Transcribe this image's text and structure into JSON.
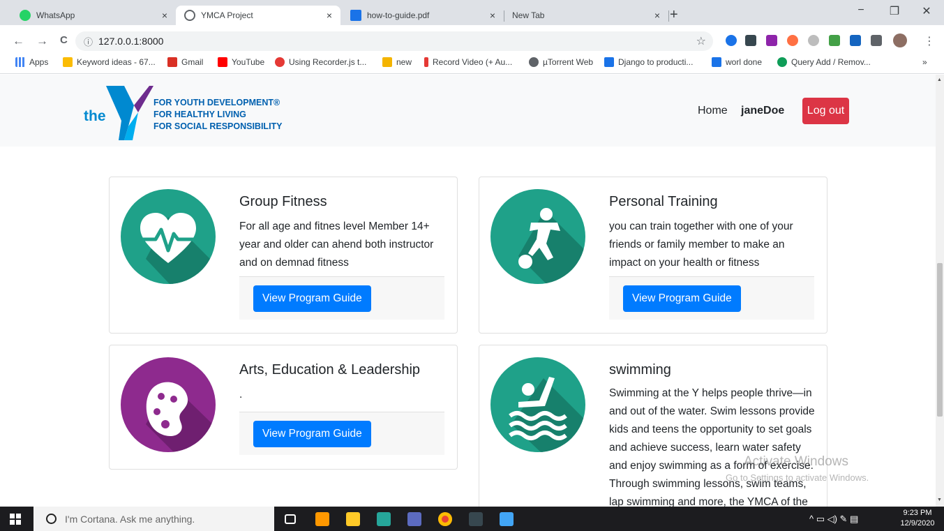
{
  "browser": {
    "tabs": [
      {
        "title": "WhatsApp",
        "icon": "whatsapp-icon",
        "active": false
      },
      {
        "title": "YMCA Project",
        "icon": "globe-icon",
        "active": true
      },
      {
        "title": "how-to-guide.pdf",
        "icon": "pdf-icon",
        "active": false
      },
      {
        "title": "New Tab",
        "icon": "",
        "active": false
      }
    ],
    "tab_close": "×",
    "new_tab": "+",
    "window_controls": {
      "minimize": "−",
      "restore": "❐",
      "close": "✕"
    },
    "nav": {
      "back": "←",
      "forward": "→",
      "reload": "C"
    },
    "url": "127.0.0.1:8000",
    "url_info": "ⓘ",
    "star": "☆",
    "bookmarks": [
      {
        "label": "Apps",
        "color": "#ea4335"
      },
      {
        "label": "Keyword ideas - 67...",
        "color": "#fbbc04"
      },
      {
        "label": "Gmail",
        "color": "#d93025"
      },
      {
        "label": "YouTube",
        "color": "#ff0000"
      },
      {
        "label": "Using Recorder.js t...",
        "color": "#e53935"
      },
      {
        "label": "new",
        "color": "#f4b400"
      },
      {
        "label": "Record Video (+ Au...",
        "color": "#e53935"
      },
      {
        "label": "µTorrent Web",
        "color": "#5f6368"
      },
      {
        "label": "Django to producti...",
        "color": "#1a73e8"
      },
      {
        "label": "worl done",
        "color": "#1a73e8"
      },
      {
        "label": "Query Add / Remov...",
        "color": "#0f9d58"
      }
    ],
    "bookmarks_more": "»"
  },
  "site": {
    "logo": {
      "the": "the",
      "tagline": [
        "FOR YOUTH DEVELOPMENT®",
        "FOR HEALTHY LIVING",
        "FOR SOCIAL RESPONSIBILITY"
      ]
    },
    "nav": {
      "home": "Home",
      "user": "janeDoe",
      "logout": "Log out"
    },
    "cards": [
      {
        "title": "Group Fitness",
        "text": "For all age and fitnes level Member 14+ year and older can ahend both instructor and on demnad fitness",
        "button": "View Program Guide",
        "icon": "heart-pulse-icon",
        "color": "#1fa189"
      },
      {
        "title": "Personal Training",
        "text": "you can train together with one of your friends or family member to make an impact on your health or fitness",
        "button": "View Program Guide",
        "icon": "soccer-player-icon",
        "color": "#1fa189"
      },
      {
        "title": "Arts, Education & Leadership",
        "text": ".",
        "button": "View Program Guide",
        "icon": "paint-palette-icon",
        "color": "#8e2a8e"
      },
      {
        "title": "swimming",
        "text": "Swimming at the Y helps people thrive—in and out of the water. Swim lessons provide kids and teens the opportunity to set goals and achieve success, learn water safety and enjoy swimming as a form of exercise. Through swimming lessons, swim teams, lap swimming and more, the YMCA of the Fox Cities provides a safe",
        "button": "View Program Guide",
        "icon": "swimmer-icon",
        "color": "#1fa189"
      }
    ]
  },
  "watermark": {
    "title": "Activate Windows",
    "subtitle": "Go to Settings to activate Windows."
  },
  "taskbar": {
    "search_placeholder": "I'm Cortana. Ask me anything.",
    "time": "9:23 PM",
    "date": "12/9/2020",
    "tray": "^ ▭ ◁) ✎ ▤"
  }
}
